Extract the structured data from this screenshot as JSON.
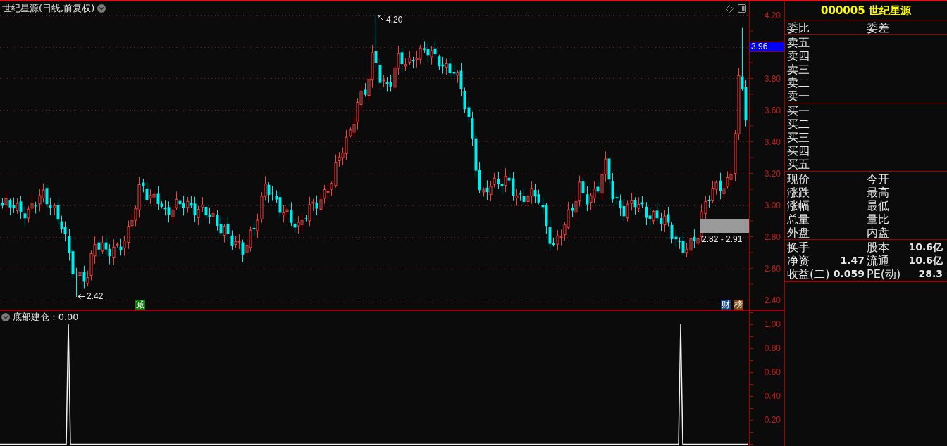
{
  "main_chart": {
    "title": "世纪星源(日线,前复权)",
    "price_axis": [
      {
        "kind": "tick",
        "label": "4.20"
      },
      {
        "kind": "current",
        "label": "3.96"
      },
      {
        "kind": "tick",
        "label": "3.80"
      },
      {
        "kind": "tick",
        "label": "3.60"
      },
      {
        "kind": "tick",
        "label": "3.40"
      },
      {
        "kind": "tick",
        "label": "3.20"
      },
      {
        "kind": "tick",
        "label": "3.00"
      },
      {
        "kind": "tick",
        "label": "2.80"
      },
      {
        "kind": "tick",
        "label": "2.60"
      },
      {
        "kind": "tick",
        "label": "2.40"
      }
    ],
    "annotations": [
      {
        "kind": "high",
        "label": "4.20"
      },
      {
        "kind": "low",
        "label": "2.42"
      },
      {
        "kind": "range",
        "label": "2.82 - 2.91"
      }
    ],
    "badges": [
      {
        "label": "减",
        "color": "#0b7d0b"
      },
      {
        "label": "财",
        "color": "#123e7c"
      },
      {
        "label": "榜",
        "color": "#7d4310"
      }
    ]
  },
  "quote_panel": {
    "title": "000005 世纪星源",
    "order_header": [
      "委比",
      "委差"
    ],
    "sell_levels": [
      "卖五",
      "卖四",
      "卖三",
      "卖二",
      "卖一"
    ],
    "buy_levels": [
      "买一",
      "买二",
      "买三",
      "买四",
      "买五"
    ],
    "quote_fields": [
      {
        "label": "现价"
      },
      {
        "label": "今开"
      },
      {
        "label": "涨跌"
      },
      {
        "label": "最高"
      },
      {
        "label": "涨幅"
      },
      {
        "label": "最低"
      },
      {
        "label": "总量"
      },
      {
        "label": "量比"
      },
      {
        "label": "外盘"
      },
      {
        "label": "内盘"
      }
    ],
    "stats": [
      {
        "label": "换手"
      },
      {
        "label": "股本",
        "value": "10.6亿"
      },
      {
        "label": "净资",
        "value": "1.47"
      },
      {
        "label": "流通",
        "value": "10.6亿"
      },
      {
        "label": "收益(二)",
        "value": "0.059"
      },
      {
        "label": "PE(动)",
        "value": "28.3"
      }
    ]
  },
  "indicator_chart": {
    "title": "底部建仓 : 0.00",
    "axis": [
      "1.00",
      "0.80",
      "0.60",
      "0.40",
      "0.20"
    ]
  }
}
